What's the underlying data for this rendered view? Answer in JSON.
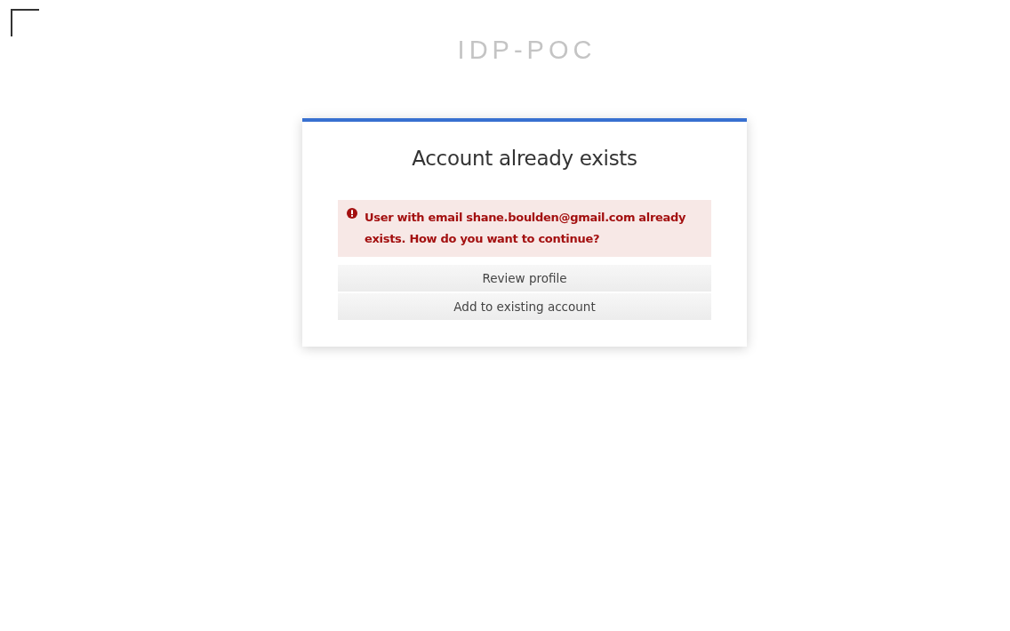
{
  "header": {
    "title": "IDP-POC"
  },
  "card": {
    "title": "Account already exists",
    "alert": {
      "kind": "error",
      "message": "User with email shane.boulden@gmail.com already exists. How do you want to continue?"
    },
    "buttons": [
      "Review profile",
      "Add to existing account"
    ]
  }
}
